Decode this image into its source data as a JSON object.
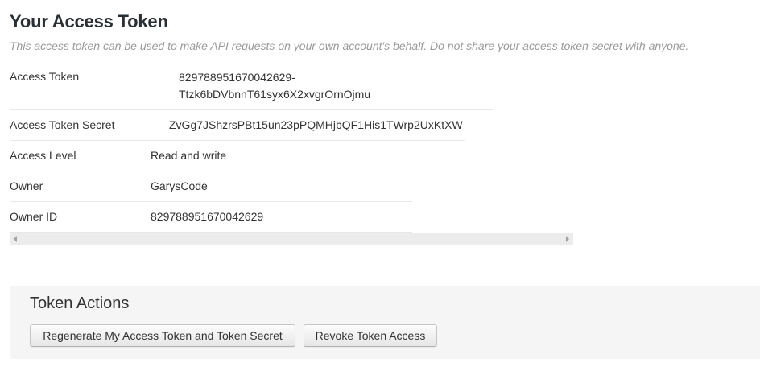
{
  "header": {
    "title": "Your Access Token",
    "subtitle": "This access token can be used to make API requests on your own account's behalf. Do not share your access token secret with anyone."
  },
  "details": {
    "access_token": {
      "label": "Access Token",
      "value_line1": "829788951670042629-",
      "value_line2": "Ttzk6bDVbnnT61syx6X2xvgrOrnOjmu"
    },
    "access_token_secret": {
      "label": "Access Token Secret",
      "value": "ZvGg7JShzrsPBt15un23pPQMHjbQF1His1TWrp2UxKtXW"
    },
    "access_level": {
      "label": "Access Level",
      "value": "Read and write"
    },
    "owner": {
      "label": "Owner",
      "value": "GarysCode"
    },
    "owner_id": {
      "label": "Owner ID",
      "value": "829788951670042629"
    }
  },
  "actions": {
    "title": "Token Actions",
    "regenerate_label": "Regenerate My Access Token and Token Secret",
    "revoke_label": "Revoke Token Access"
  }
}
